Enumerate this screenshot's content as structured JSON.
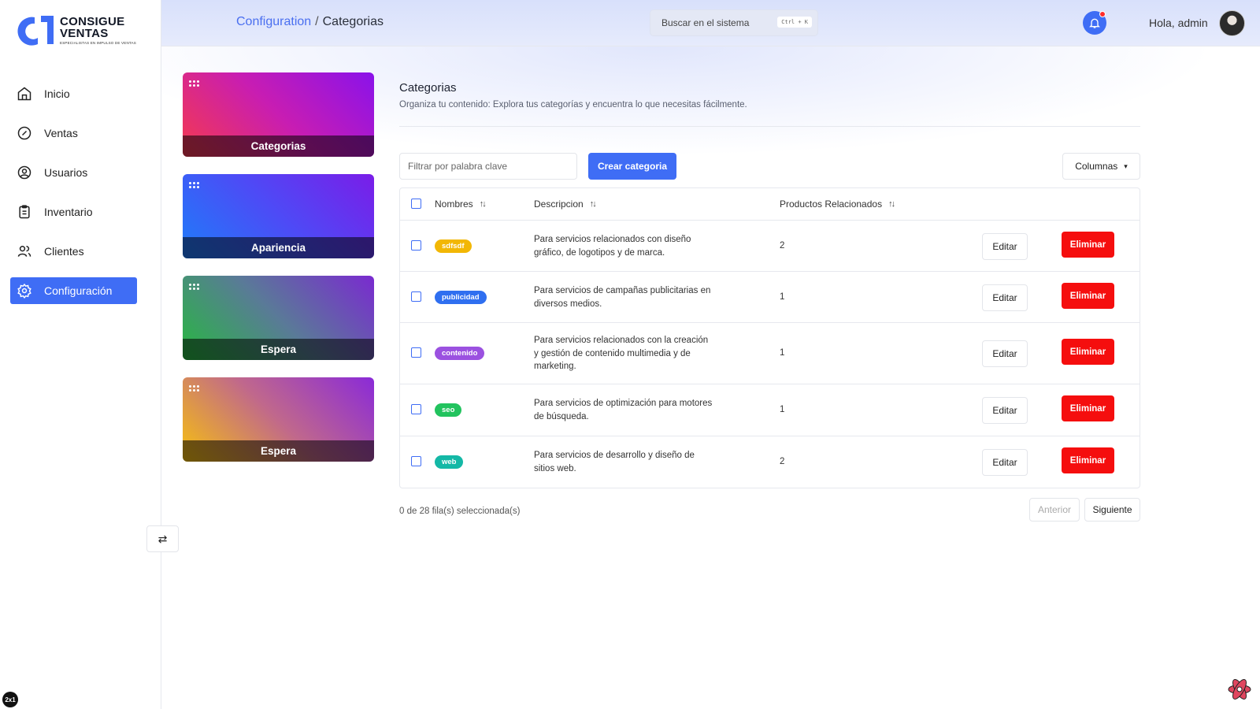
{
  "brand": {
    "line1": "CONSIGUE",
    "line2": "VENTAS",
    "tagline": "ESPECIALISTAS EN IMPULSO DE VENTAS",
    "color": "#3f6df5"
  },
  "sidebar": {
    "items": [
      {
        "label": "Inicio",
        "icon": "home-icon"
      },
      {
        "label": "Ventas",
        "icon": "percent-circle-icon"
      },
      {
        "label": "Usuarios",
        "icon": "user-circle-icon"
      },
      {
        "label": "Inventario",
        "icon": "clipboard-icon"
      },
      {
        "label": "Clientes",
        "icon": "users-icon"
      },
      {
        "label": "Configuración",
        "icon": "gear-icon",
        "active": true
      }
    ],
    "toggle_icon": "swap-arrows-icon",
    "badge": "2x1"
  },
  "header": {
    "breadcrumb": {
      "parent": "Configuration",
      "separator": "/",
      "current": "Categorias"
    },
    "search": {
      "placeholder": "Buscar en el sistema",
      "shortcut": "Ctrl + K"
    },
    "greeting": "Hola, admin"
  },
  "cards": [
    {
      "label": "Categorias"
    },
    {
      "label": "Apariencia"
    },
    {
      "label": "Espera"
    },
    {
      "label": "Espera"
    }
  ],
  "page": {
    "title": "Categorias",
    "description": "Organiza tu contenido: Explora tus categorías y encuentra lo que necesitas fácilmente."
  },
  "toolbar": {
    "filter_placeholder": "Filtrar por palabra clave",
    "create_label": "Crear categoria",
    "columns_label": "Columnas"
  },
  "table": {
    "headers": {
      "name": "Nombres",
      "description": "Descripcion",
      "products": "Productos Relacionados"
    },
    "edit_label": "Editar",
    "delete_label": "Eliminar",
    "rows": [
      {
        "name": "sdfsdf",
        "color": "#f2b705",
        "description": "Para servicios relacionados con diseño gráfico, de logotipos y de marca.",
        "products": "2"
      },
      {
        "name": "publicidad",
        "color": "#2f6ff0",
        "description": "Para servicios de campañas publicitarias en diversos medios.",
        "products": "1"
      },
      {
        "name": "contenido",
        "color": "#9b51e0",
        "description": "Para servicios relacionados con la creación y gestión de contenido multimedia y de marketing.",
        "products": "1"
      },
      {
        "name": "seo",
        "color": "#22c35e",
        "description": "Para servicios de optimización para motores de búsqueda.",
        "products": "1"
      },
      {
        "name": "web",
        "color": "#14b8a6",
        "description": "Para servicios de desarrollo y diseño de sitios web.",
        "products": "2"
      }
    ]
  },
  "footer": {
    "selection": "0 de 28 fila(s) seleccionada(s)",
    "prev_label": "Anterior",
    "next_label": "Siguiente"
  }
}
